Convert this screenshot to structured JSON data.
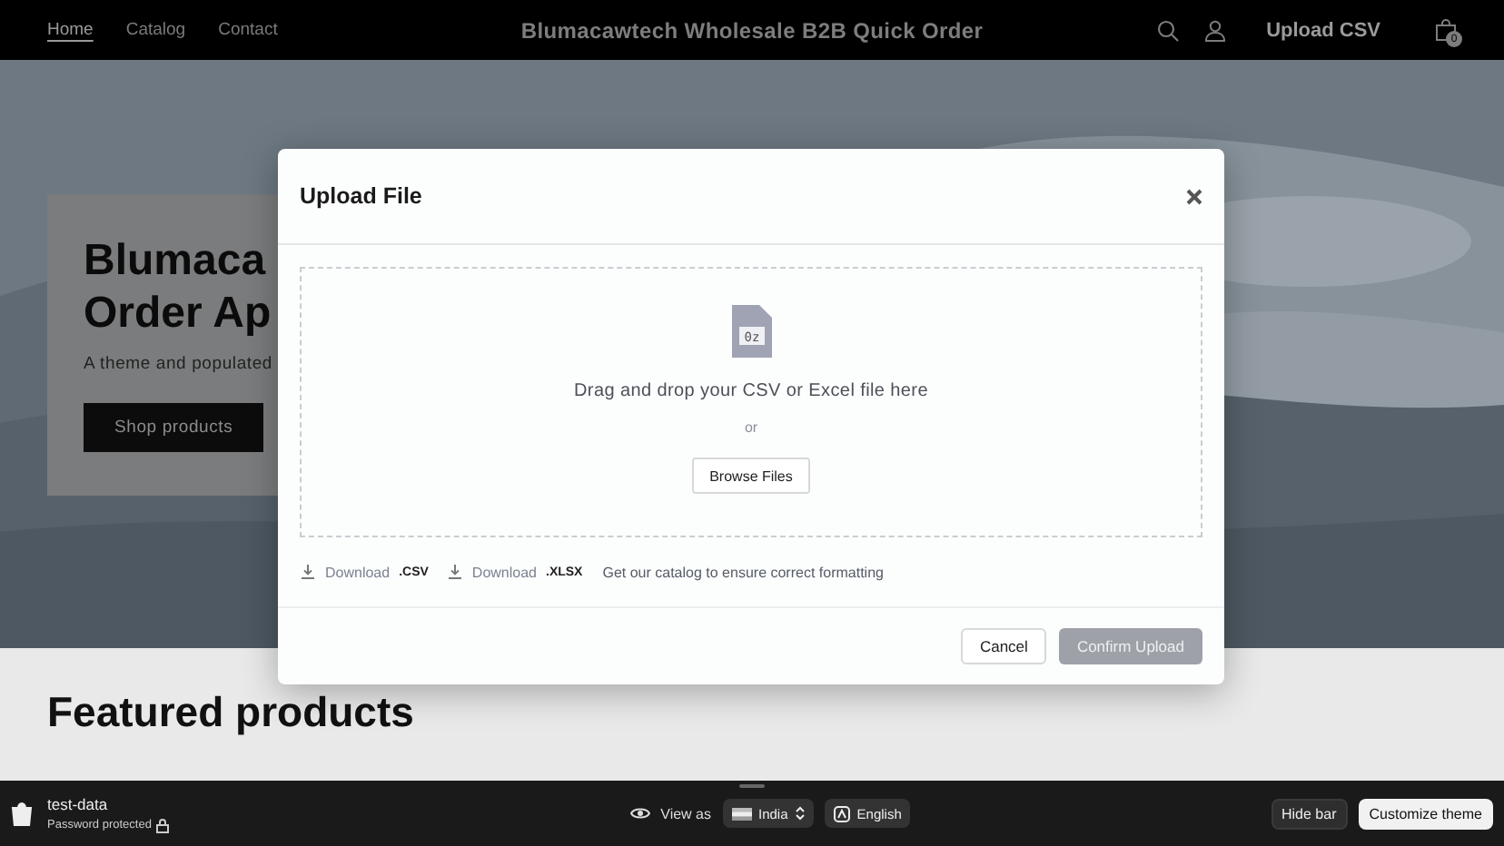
{
  "header": {
    "nav": [
      {
        "label": "Home",
        "selected": true
      },
      {
        "label": "Catalog",
        "selected": false
      },
      {
        "label": "Contact",
        "selected": false
      }
    ],
    "title": "Blumacawtech Wholesale B2B Quick Order",
    "upload_label": "Upload CSV",
    "cart_count": "0"
  },
  "hero": {
    "title_lines": [
      "Blumaca",
      "Order Ap"
    ],
    "subtitle": "A theme and populated",
    "button": "Shop products"
  },
  "featured": {
    "heading": "Featured products"
  },
  "modal": {
    "title": "Upload File",
    "dropzone": {
      "file_label": "0z",
      "text": "Drag and drop your CSV or Excel file here",
      "or": "or",
      "browse": "Browse Files"
    },
    "downloads": [
      {
        "label": "Download",
        "ext": ".CSV"
      },
      {
        "label": "Download",
        "ext": ".XLSX"
      }
    ],
    "note": "Get our catalog to ensure correct formatting",
    "buttons": [
      {
        "label": "Cancel",
        "kind": "secondary",
        "disabled": false
      },
      {
        "label": "Confirm Upload",
        "kind": "primary",
        "disabled": true
      }
    ]
  },
  "preview_bar": {
    "store": "test-data",
    "status": "Password protected",
    "view_as": "View as",
    "country": "India",
    "language": "English",
    "hide": "Hide bar",
    "customize": "Customize theme"
  }
}
